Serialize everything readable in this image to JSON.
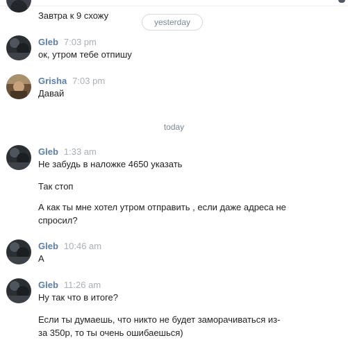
{
  "separators": {
    "yesterday": "yesterday",
    "today": "today"
  },
  "top_partial": {
    "text": "Завтра к 9 схожу"
  },
  "messages": [
    {
      "name": "Gleb",
      "time": "7:03 pm",
      "lines": [
        "ок, утром тебе отпишу"
      ]
    },
    {
      "name": "Grisha",
      "time": "7:03 pm",
      "lines": [
        "Давай"
      ]
    },
    {
      "name": "Gleb",
      "time": "1:33 am",
      "lines": [
        "Не забудь в наложке 4650 указать",
        "Так стоп",
        "А как ты мне хотел утром отправить , если даже адреса не",
        "спросил?"
      ]
    },
    {
      "name": "Gleb",
      "time": "10:46 am",
      "lines": [
        "А"
      ]
    },
    {
      "name": "Gleb",
      "time": "11:26 am",
      "lines": [
        "Ну так что в итоге?",
        "Если ты думаешь, что никто не будет заморачиваться из-",
        "за 350р, то ты очень ошибаешься)"
      ]
    }
  ],
  "colors": {
    "name": "#5b7fa6",
    "time": "#a8b0b8",
    "text": "#1f1f1f",
    "separator_text": "#7c8793"
  }
}
